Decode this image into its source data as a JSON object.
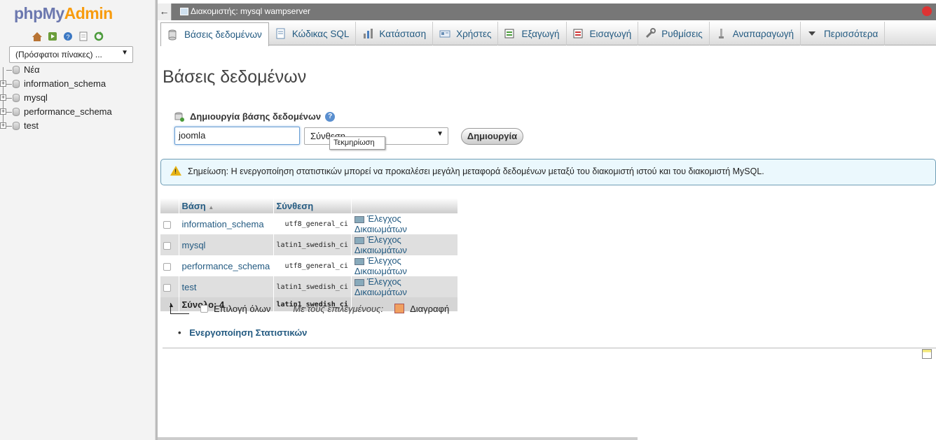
{
  "logo": {
    "php": "php",
    "my": "My",
    "admin": "Admin"
  },
  "navicons": [
    "home-icon",
    "logout-icon",
    "help-icon",
    "docs-icon",
    "reload-icon"
  ],
  "recent": {
    "label": "(Πρόσφατοι πίνακες) ..."
  },
  "tree": {
    "new_label": "Νέα",
    "databases": [
      "information_schema",
      "mysql",
      "performance_schema",
      "test"
    ]
  },
  "topbar": {
    "title": "Διακομιστής: mysql wampserver",
    "back": "←"
  },
  "menu": {
    "tabs": [
      {
        "label": "Βάσεις δεδομένων",
        "icon": "database-icon"
      },
      {
        "label": "Κώδικας SQL",
        "icon": "sql-icon"
      },
      {
        "label": "Κατάσταση",
        "icon": "status-icon"
      },
      {
        "label": "Χρήστες",
        "icon": "users-icon"
      },
      {
        "label": "Εξαγωγή",
        "icon": "export-icon"
      },
      {
        "label": "Εισαγωγή",
        "icon": "import-icon"
      },
      {
        "label": "Ρυθμίσεις",
        "icon": "settings-icon"
      },
      {
        "label": "Αναπαραγωγή",
        "icon": "replication-icon"
      },
      {
        "label": "Περισσότερα",
        "icon": "more-icon"
      }
    ]
  },
  "page": {
    "title": "Βάσεις δεδομένων"
  },
  "create": {
    "header": "Δημιουργία βάσης δεδομένων",
    "dbname_value": "joomla",
    "collation_placeholder": "Σύνθεση",
    "tooltip": "Τεκμηρίωση",
    "button": "Δημιουργία",
    "help": "?"
  },
  "notice": {
    "text": "Σημείωση: Η ενεργοποίηση στατιστικών μπορεί να προκαλέσει μεγάλη μεταφορά δεδομένων μεταξύ του διακομιστή ιστού και του διακομιστή MySQL."
  },
  "table": {
    "headers": {
      "db": "Βάση",
      "sort": "▲",
      "collation": "Σύνθεση"
    },
    "rows": [
      {
        "name": "information_schema",
        "collation": "utf8_general_ci",
        "priv": "Έλεγχος Δικαιωμάτων"
      },
      {
        "name": "mysql",
        "collation": "latin1_swedish_ci",
        "priv": "Έλεγχος Δικαιωμάτων"
      },
      {
        "name": "performance_schema",
        "collation": "utf8_general_ci",
        "priv": "Έλεγχος Δικαιωμάτων"
      },
      {
        "name": "test",
        "collation": "latin1_swedish_ci",
        "priv": "Έλεγχος Δικαιωμάτων"
      }
    ],
    "total": {
      "label": "Σύνολο: 4",
      "collation": "latin1_swedish_ci"
    }
  },
  "actions": {
    "select_all": "Επιλογή όλων",
    "with_selected": "Με τους επιλεγμένους:",
    "delete": "Διαγραφή"
  },
  "stats": {
    "bullet": "•",
    "link": "Ενεργοποίηση Στατιστικών"
  },
  "colors": {
    "link": "#235a81",
    "notice_bg": "#ebf8fd",
    "topbar": "#777777",
    "logo_php": "#6c78af",
    "logo_admin": "#f89c0e"
  }
}
